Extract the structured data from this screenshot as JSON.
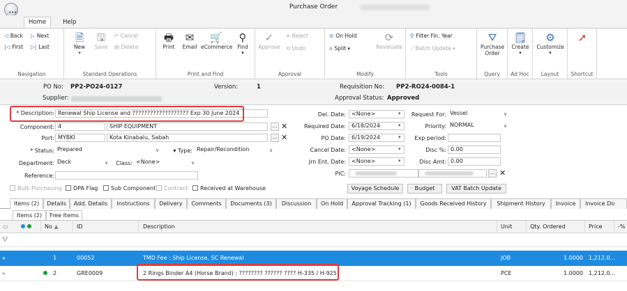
{
  "window": {
    "title": "Purchase Order"
  },
  "ribbon_tabs": [
    "Home",
    "Help"
  ],
  "ribbon": {
    "navigation": {
      "back": "Back",
      "next": "Next",
      "first": "First",
      "last": "Last",
      "label": "Navigation"
    },
    "standard_ops": {
      "new": "New",
      "save": "Save",
      "cancel": "Cancel",
      "delete": "Delete",
      "label": "Standard Operations"
    },
    "print_find": {
      "print": "Print",
      "email": "Email",
      "ecommerce": "eCommerce",
      "find": "Find",
      "label": "Print and Find"
    },
    "approval": {
      "approve": "Approve",
      "reject": "Reject",
      "undo": "Undo",
      "label": "Approval"
    },
    "modify": {
      "on_hold": "On Hold",
      "split": "Split",
      "revaluate": "Revaluate",
      "label": "Modify"
    },
    "tools": {
      "filter_fin_year": "Filter Fin. Year",
      "batch_update": "Batch Update",
      "label": "Tools"
    },
    "query": {
      "purchase_order": "Purchase Order",
      "label": "Query"
    },
    "ad_hoc": {
      "create": "Create",
      "label": "Ad Hoc"
    },
    "layout": {
      "customize": "Customize",
      "label": "Layout"
    },
    "shortcut": {
      "label": "Shortcut"
    }
  },
  "header": {
    "po_no_label": "PO No:",
    "po_no": "PP2-PO24-0127",
    "version_label": "Version:",
    "version": "1",
    "requisition_label": "Requisition No:",
    "requisition": "PP2-RO24-0084-1",
    "supplier_label": "Supplier:",
    "approval_status_label": "Approval Status:",
    "approval_status": "Approved"
  },
  "form": {
    "description_label": "* Description:",
    "description": "Renewal Ship License and ??????????????????? Exp 30 June 2024",
    "component_label": "Component:",
    "component_code": "4",
    "component_name": "SHIP EQUIPMENT",
    "port_label": "Port:",
    "port_code": "MYBKI",
    "port_name": "Kota Kinabalu, Sabah",
    "status_label": "* Status:",
    "status": "Prepared",
    "type_label": "Type:",
    "type": "Repair/Recondition",
    "department_label": "Department:",
    "department": "Deck",
    "class_label": "Class:",
    "class": "<None>",
    "reference_label": "Reference:",
    "del_date_label": "Del. Date:",
    "del_date": "<None>",
    "required_date_label": "Required Date:",
    "required_date": "6/18/2024",
    "po_date_label": "PO Date:",
    "po_date": "6/19/2024",
    "cancel_date_label": "Cancel Date:",
    "cancel_date": "<None>",
    "jrn_ent_date_label": "Jrn Ent. Date:",
    "jrn_ent_date": "<None>",
    "pic_label": "PIC:",
    "request_for_label": "Request For:",
    "request_for": "Vessel",
    "priority_label": "Priority:",
    "priority": "NORMAL",
    "exp_period_label": "Exp period:",
    "disc_pct_label": "Disc %:",
    "disc_pct": "0.00",
    "disc_amt_label": "Disc Amt:",
    "disc_amt": "0.00",
    "checks": {
      "bulk_purchasing": "Bulk Purchasing",
      "dpa_flag": "DPA Flag",
      "sub_component": "Sub Component",
      "contract": "Contract",
      "received_at_warehouse": "Received at Warehouse"
    },
    "buttons": {
      "voyage_schedule": "Voyage Schedule",
      "budget": "Budget",
      "vat_batch_update": "VAT Batch Update"
    }
  },
  "tabs": [
    "Items (2)",
    "Details",
    "Add. Details",
    "Instructions",
    "Delivery",
    "Comments",
    "Documents (3)",
    "Discussion",
    "On Hold",
    "Approval Tracking (1)",
    "Goods Received History",
    "Shipment History",
    "Invoice",
    "Invoice Do"
  ],
  "subtabs": [
    "Items (2)",
    "Free Items"
  ],
  "grid": {
    "columns": {
      "no": "No",
      "id": "ID",
      "description": "Description",
      "unit": "Unit",
      "qty": "Qty. Ordered",
      "price": "Price",
      "pct": "-%"
    },
    "rows": [
      {
        "no": "1",
        "id": "00052",
        "description": "TMD Fee : Ship License, SC Renewal",
        "unit": "JOB",
        "qty": "1.0000",
        "price": "1,212.0..."
      },
      {
        "no": "2",
        "id": "GRE0009",
        "description": "2 Rings Binder A4 (Horse Brand) : ???????? ?????? ???? H-335 / H-925",
        "unit": "PCE",
        "qty": "1.0000",
        "price": "1,212.0..."
      }
    ]
  },
  "colors": {
    "selected_row": "#1e8be0",
    "highlight_box": "#e03a3a",
    "accent": "#3c6ea8",
    "ok_dot": "#1a9e3c"
  }
}
